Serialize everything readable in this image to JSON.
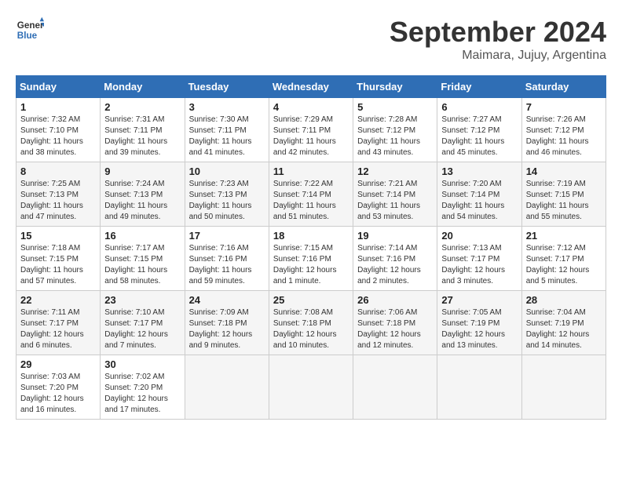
{
  "header": {
    "logo_line1": "General",
    "logo_line2": "Blue",
    "month_title": "September 2024",
    "location": "Maimara, Jujuy, Argentina"
  },
  "weekdays": [
    "Sunday",
    "Monday",
    "Tuesday",
    "Wednesday",
    "Thursday",
    "Friday",
    "Saturday"
  ],
  "weeks": [
    [
      {
        "day": "1",
        "info": "Sunrise: 7:32 AM\nSunset: 7:10 PM\nDaylight: 11 hours and 38 minutes."
      },
      {
        "day": "2",
        "info": "Sunrise: 7:31 AM\nSunset: 7:11 PM\nDaylight: 11 hours and 39 minutes."
      },
      {
        "day": "3",
        "info": "Sunrise: 7:30 AM\nSunset: 7:11 PM\nDaylight: 11 hours and 41 minutes."
      },
      {
        "day": "4",
        "info": "Sunrise: 7:29 AM\nSunset: 7:11 PM\nDaylight: 11 hours and 42 minutes."
      },
      {
        "day": "5",
        "info": "Sunrise: 7:28 AM\nSunset: 7:12 PM\nDaylight: 11 hours and 43 minutes."
      },
      {
        "day": "6",
        "info": "Sunrise: 7:27 AM\nSunset: 7:12 PM\nDaylight: 11 hours and 45 minutes."
      },
      {
        "day": "7",
        "info": "Sunrise: 7:26 AM\nSunset: 7:12 PM\nDaylight: 11 hours and 46 minutes."
      }
    ],
    [
      {
        "day": "8",
        "info": "Sunrise: 7:25 AM\nSunset: 7:13 PM\nDaylight: 11 hours and 47 minutes."
      },
      {
        "day": "9",
        "info": "Sunrise: 7:24 AM\nSunset: 7:13 PM\nDaylight: 11 hours and 49 minutes."
      },
      {
        "day": "10",
        "info": "Sunrise: 7:23 AM\nSunset: 7:13 PM\nDaylight: 11 hours and 50 minutes."
      },
      {
        "day": "11",
        "info": "Sunrise: 7:22 AM\nSunset: 7:14 PM\nDaylight: 11 hours and 51 minutes."
      },
      {
        "day": "12",
        "info": "Sunrise: 7:21 AM\nSunset: 7:14 PM\nDaylight: 11 hours and 53 minutes."
      },
      {
        "day": "13",
        "info": "Sunrise: 7:20 AM\nSunset: 7:14 PM\nDaylight: 11 hours and 54 minutes."
      },
      {
        "day": "14",
        "info": "Sunrise: 7:19 AM\nSunset: 7:15 PM\nDaylight: 11 hours and 55 minutes."
      }
    ],
    [
      {
        "day": "15",
        "info": "Sunrise: 7:18 AM\nSunset: 7:15 PM\nDaylight: 11 hours and 57 minutes."
      },
      {
        "day": "16",
        "info": "Sunrise: 7:17 AM\nSunset: 7:15 PM\nDaylight: 11 hours and 58 minutes."
      },
      {
        "day": "17",
        "info": "Sunrise: 7:16 AM\nSunset: 7:16 PM\nDaylight: 11 hours and 59 minutes."
      },
      {
        "day": "18",
        "info": "Sunrise: 7:15 AM\nSunset: 7:16 PM\nDaylight: 12 hours and 1 minute."
      },
      {
        "day": "19",
        "info": "Sunrise: 7:14 AM\nSunset: 7:16 PM\nDaylight: 12 hours and 2 minutes."
      },
      {
        "day": "20",
        "info": "Sunrise: 7:13 AM\nSunset: 7:17 PM\nDaylight: 12 hours and 3 minutes."
      },
      {
        "day": "21",
        "info": "Sunrise: 7:12 AM\nSunset: 7:17 PM\nDaylight: 12 hours and 5 minutes."
      }
    ],
    [
      {
        "day": "22",
        "info": "Sunrise: 7:11 AM\nSunset: 7:17 PM\nDaylight: 12 hours and 6 minutes."
      },
      {
        "day": "23",
        "info": "Sunrise: 7:10 AM\nSunset: 7:17 PM\nDaylight: 12 hours and 7 minutes."
      },
      {
        "day": "24",
        "info": "Sunrise: 7:09 AM\nSunset: 7:18 PM\nDaylight: 12 hours and 9 minutes."
      },
      {
        "day": "25",
        "info": "Sunrise: 7:08 AM\nSunset: 7:18 PM\nDaylight: 12 hours and 10 minutes."
      },
      {
        "day": "26",
        "info": "Sunrise: 7:06 AM\nSunset: 7:18 PM\nDaylight: 12 hours and 12 minutes."
      },
      {
        "day": "27",
        "info": "Sunrise: 7:05 AM\nSunset: 7:19 PM\nDaylight: 12 hours and 13 minutes."
      },
      {
        "day": "28",
        "info": "Sunrise: 7:04 AM\nSunset: 7:19 PM\nDaylight: 12 hours and 14 minutes."
      }
    ],
    [
      {
        "day": "29",
        "info": "Sunrise: 7:03 AM\nSunset: 7:20 PM\nDaylight: 12 hours and 16 minutes."
      },
      {
        "day": "30",
        "info": "Sunrise: 7:02 AM\nSunset: 7:20 PM\nDaylight: 12 hours and 17 minutes."
      },
      {
        "day": "",
        "info": ""
      },
      {
        "day": "",
        "info": ""
      },
      {
        "day": "",
        "info": ""
      },
      {
        "day": "",
        "info": ""
      },
      {
        "day": "",
        "info": ""
      }
    ]
  ]
}
